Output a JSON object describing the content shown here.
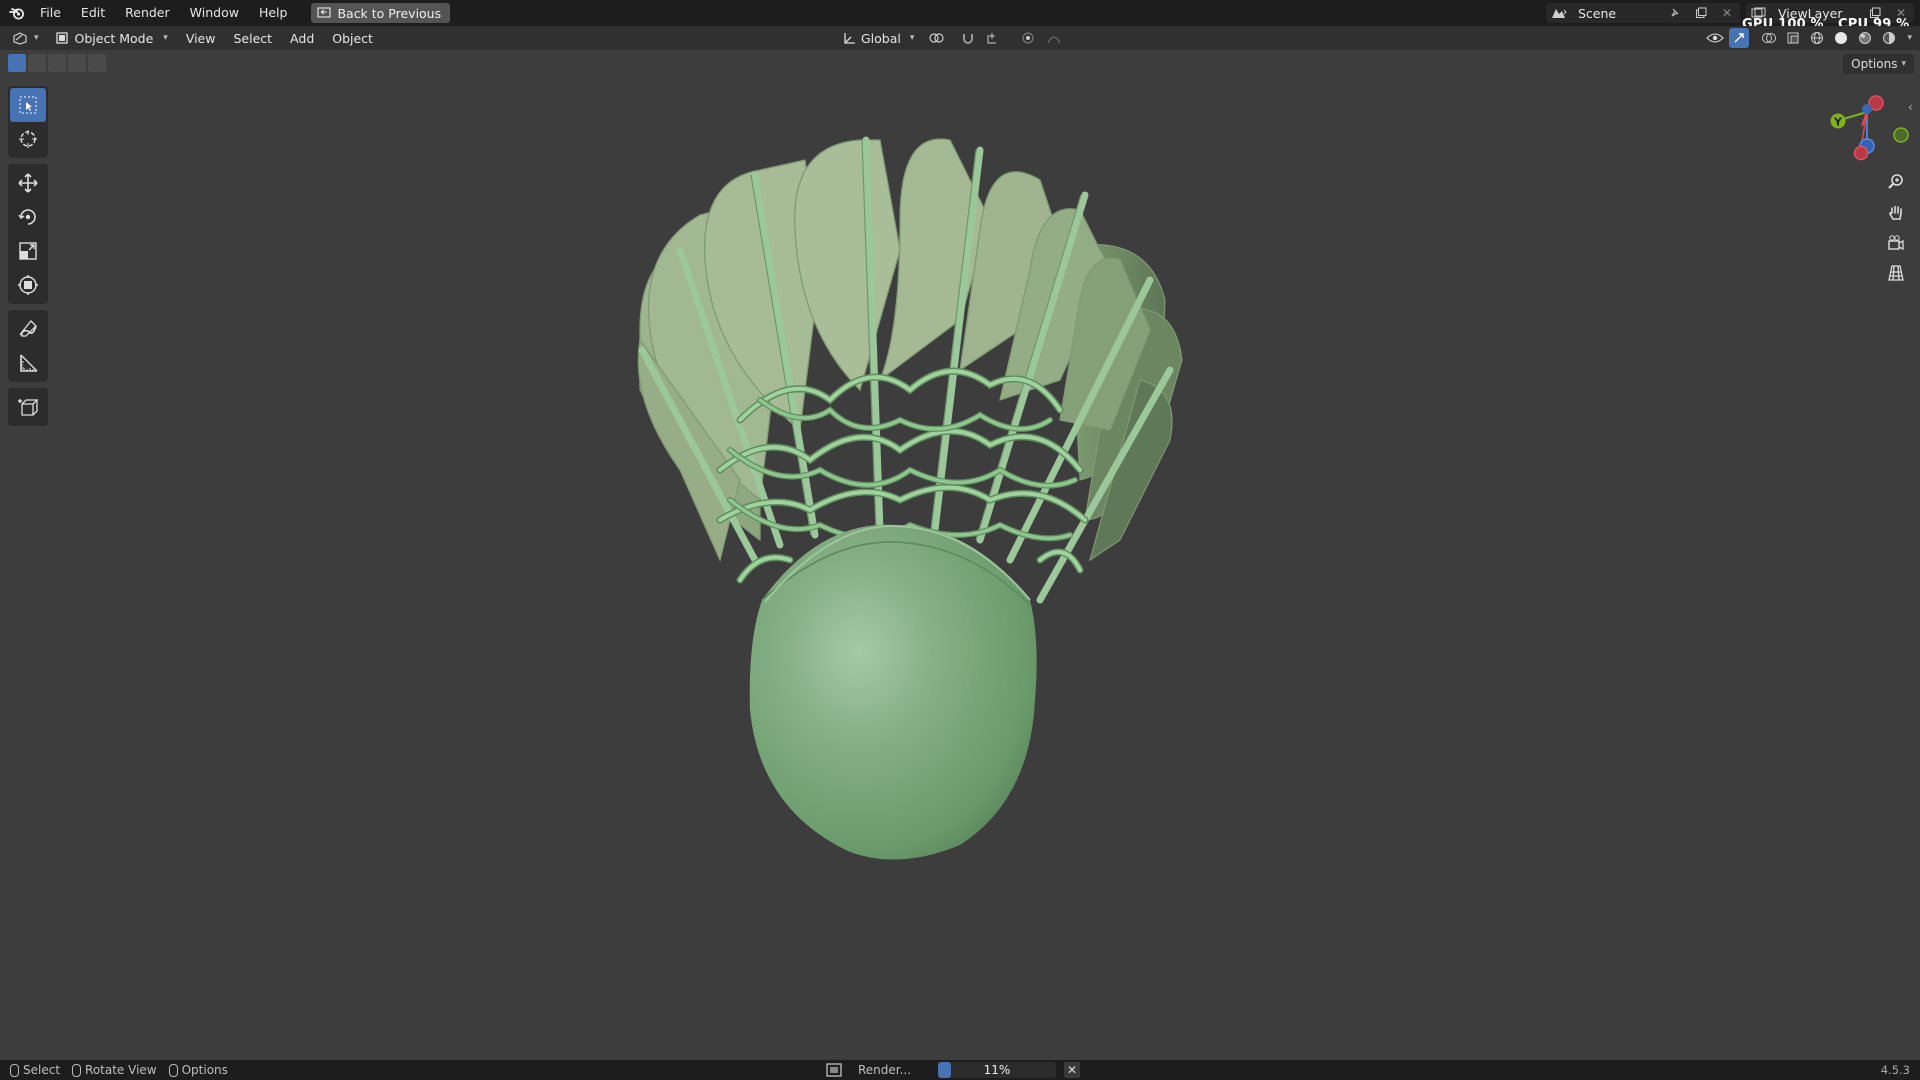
{
  "menu": {
    "items": [
      "File",
      "Edit",
      "Render",
      "Window",
      "Help"
    ],
    "back_label": "Back to Previous"
  },
  "scene": {
    "name": "Scene",
    "view_layer": "ViewLayer"
  },
  "stats": {
    "gpu_label": "GPU",
    "gpu_value": "100 %",
    "cpu_label": "CPU",
    "cpu_value": "99 %"
  },
  "header": {
    "mode": "Object Mode",
    "menus": [
      "View",
      "Select",
      "Add",
      "Object"
    ],
    "transform_orientation": "Global",
    "options_label": "Options"
  },
  "status": {
    "select": "Select",
    "rotate": "Rotate View",
    "options": "Options",
    "render_label": "Render...",
    "progress": 0.11,
    "progress_text": "11%",
    "version": "4.5.3"
  },
  "gizmo": {
    "y_label": "Y"
  },
  "colors": {
    "accent": "#4772b3",
    "model": "#7aa57d",
    "background": "#3d3d3d"
  }
}
